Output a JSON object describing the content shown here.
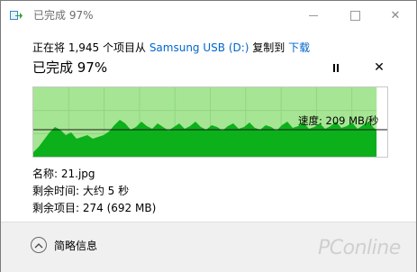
{
  "window": {
    "title": "已完成 97%",
    "icon": "copy-arrow-icon"
  },
  "operation": {
    "prefix": "正在将 1,945 个项目从 ",
    "source": "Samsung USB (D:)",
    "middle": " 复制到 ",
    "destination": "下载"
  },
  "status": "已完成 97%",
  "graph": {
    "progress_percent": 97,
    "speed_label": "速度: 209 MB/秒",
    "colors": {
      "background": "#ffffff",
      "completed_bg": "#a6e594",
      "area_fill": "#0cb01b",
      "grid": "#8fd77e",
      "speed_line": "#1a1a1a"
    }
  },
  "details": {
    "name": "名称: 21.jpg",
    "time_remaining": "剩余时间: 大约 5 秒",
    "items_remaining": "剩余项目: 274 (692 MB)"
  },
  "footer": {
    "less_details": "简略信息"
  },
  "watermark": "PConline"
}
